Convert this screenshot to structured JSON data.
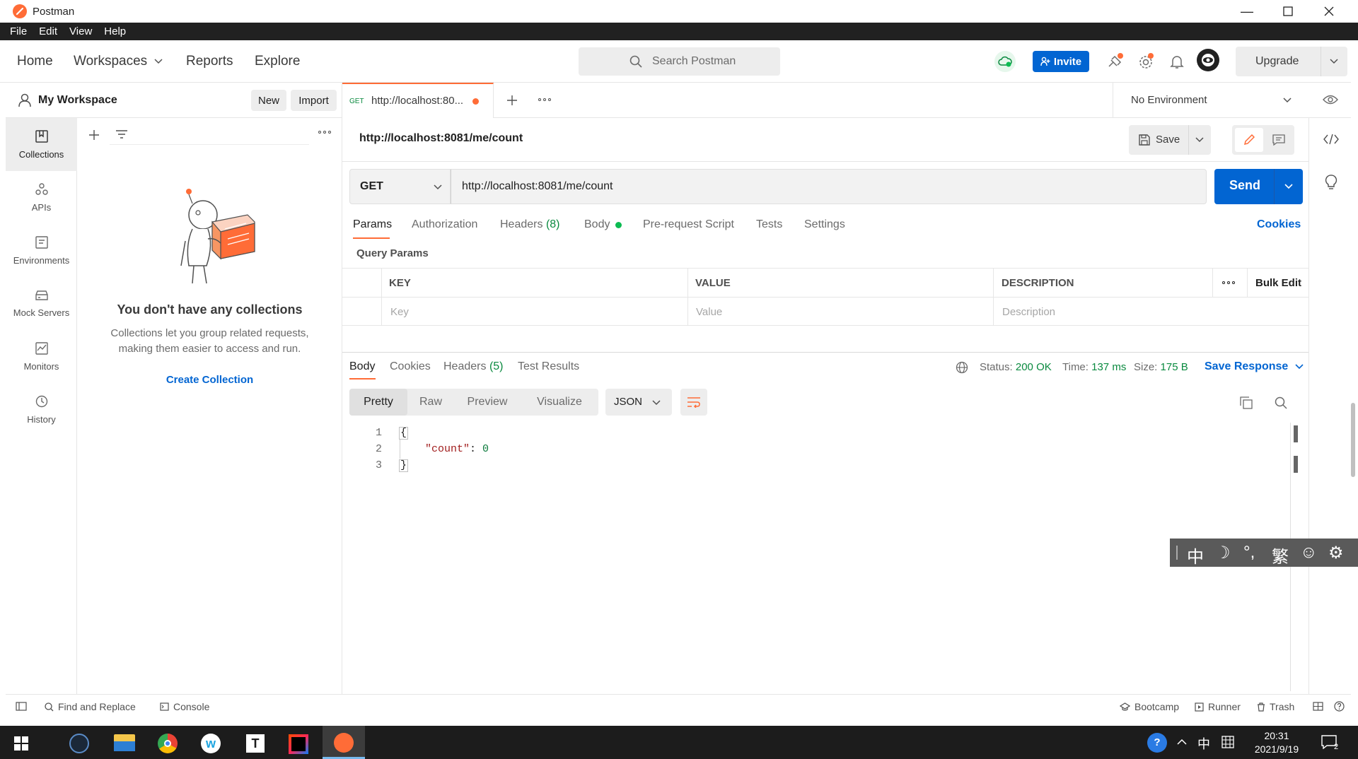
{
  "window": {
    "title": "Postman"
  },
  "menu": [
    "File",
    "Edit",
    "View",
    "Help"
  ],
  "header": {
    "nav": [
      "Home",
      "Workspaces",
      "Reports",
      "Explore"
    ],
    "search_placeholder": "Search Postman",
    "invite_label": "Invite",
    "upgrade_label": "Upgrade"
  },
  "workspace": {
    "name": "My Workspace",
    "new_label": "New",
    "import_label": "Import"
  },
  "rail": [
    {
      "label": "Collections",
      "icon": "collections-icon"
    },
    {
      "label": "APIs",
      "icon": "apis-icon"
    },
    {
      "label": "Environments",
      "icon": "environments-icon"
    },
    {
      "label": "Mock Servers",
      "icon": "mock-servers-icon"
    },
    {
      "label": "Monitors",
      "icon": "monitors-icon"
    },
    {
      "label": "History",
      "icon": "history-icon"
    }
  ],
  "sidebar": {
    "empty_title": "You don't have any collections",
    "empty_text_1": "Collections let you group related requests,",
    "empty_text_2": "making them easier to access and run.",
    "create_label": "Create Collection"
  },
  "tab": {
    "method": "GET",
    "title": "http://localhost:80..."
  },
  "environment": {
    "selected": "No Environment"
  },
  "request": {
    "name": "http://localhost:8081/me/count",
    "save_label": "Save",
    "method": "GET",
    "url": "http://localhost:8081/me/count",
    "send_label": "Send",
    "cookies_label": "Cookies",
    "tabs": [
      {
        "label": "Params",
        "count": ""
      },
      {
        "label": "Authorization",
        "count": ""
      },
      {
        "label": "Headers",
        "count": "(8)"
      },
      {
        "label": "Body",
        "count": ""
      },
      {
        "label": "Pre-request Script",
        "count": ""
      },
      {
        "label": "Tests",
        "count": ""
      },
      {
        "label": "Settings",
        "count": ""
      }
    ],
    "query_params_title": "Query Params",
    "table": {
      "headers": [
        "KEY",
        "VALUE",
        "DESCRIPTION"
      ],
      "placeholders": [
        "Key",
        "Value",
        "Description"
      ],
      "bulk_edit": "Bulk Edit"
    }
  },
  "response": {
    "tabs": [
      "Body",
      "Cookies",
      "Headers",
      "Test Results"
    ],
    "headers_count": "(5)",
    "status_label": "Status:",
    "status_value": "200 OK",
    "time_label": "Time:",
    "time_value": "137 ms",
    "size_label": "Size:",
    "size_value": "175 B",
    "save_response_label": "Save Response",
    "views": [
      "Pretty",
      "Raw",
      "Preview",
      "Visualize"
    ],
    "format": "JSON",
    "lines": [
      {
        "n": "1",
        "text": "{"
      },
      {
        "n": "2",
        "key": "\"count\"",
        "sep": ": ",
        "value": "0"
      },
      {
        "n": "3",
        "text": "}"
      }
    ]
  },
  "ime": [
    "中",
    "☽",
    "°,",
    "繁",
    "☺",
    "⚙"
  ],
  "statusbar": {
    "find_replace": "Find and Replace",
    "console": "Console",
    "bootcamp": "Bootcamp",
    "runner": "Runner",
    "trash": "Trash"
  },
  "taskbar": {
    "time": "20:31",
    "date": "2021/9/19",
    "lang": "中"
  },
  "colors": {
    "accent": "#ff6c37",
    "primary": "#0265d2",
    "success": "#0cbb52",
    "status_green": "#0a8a3f"
  }
}
